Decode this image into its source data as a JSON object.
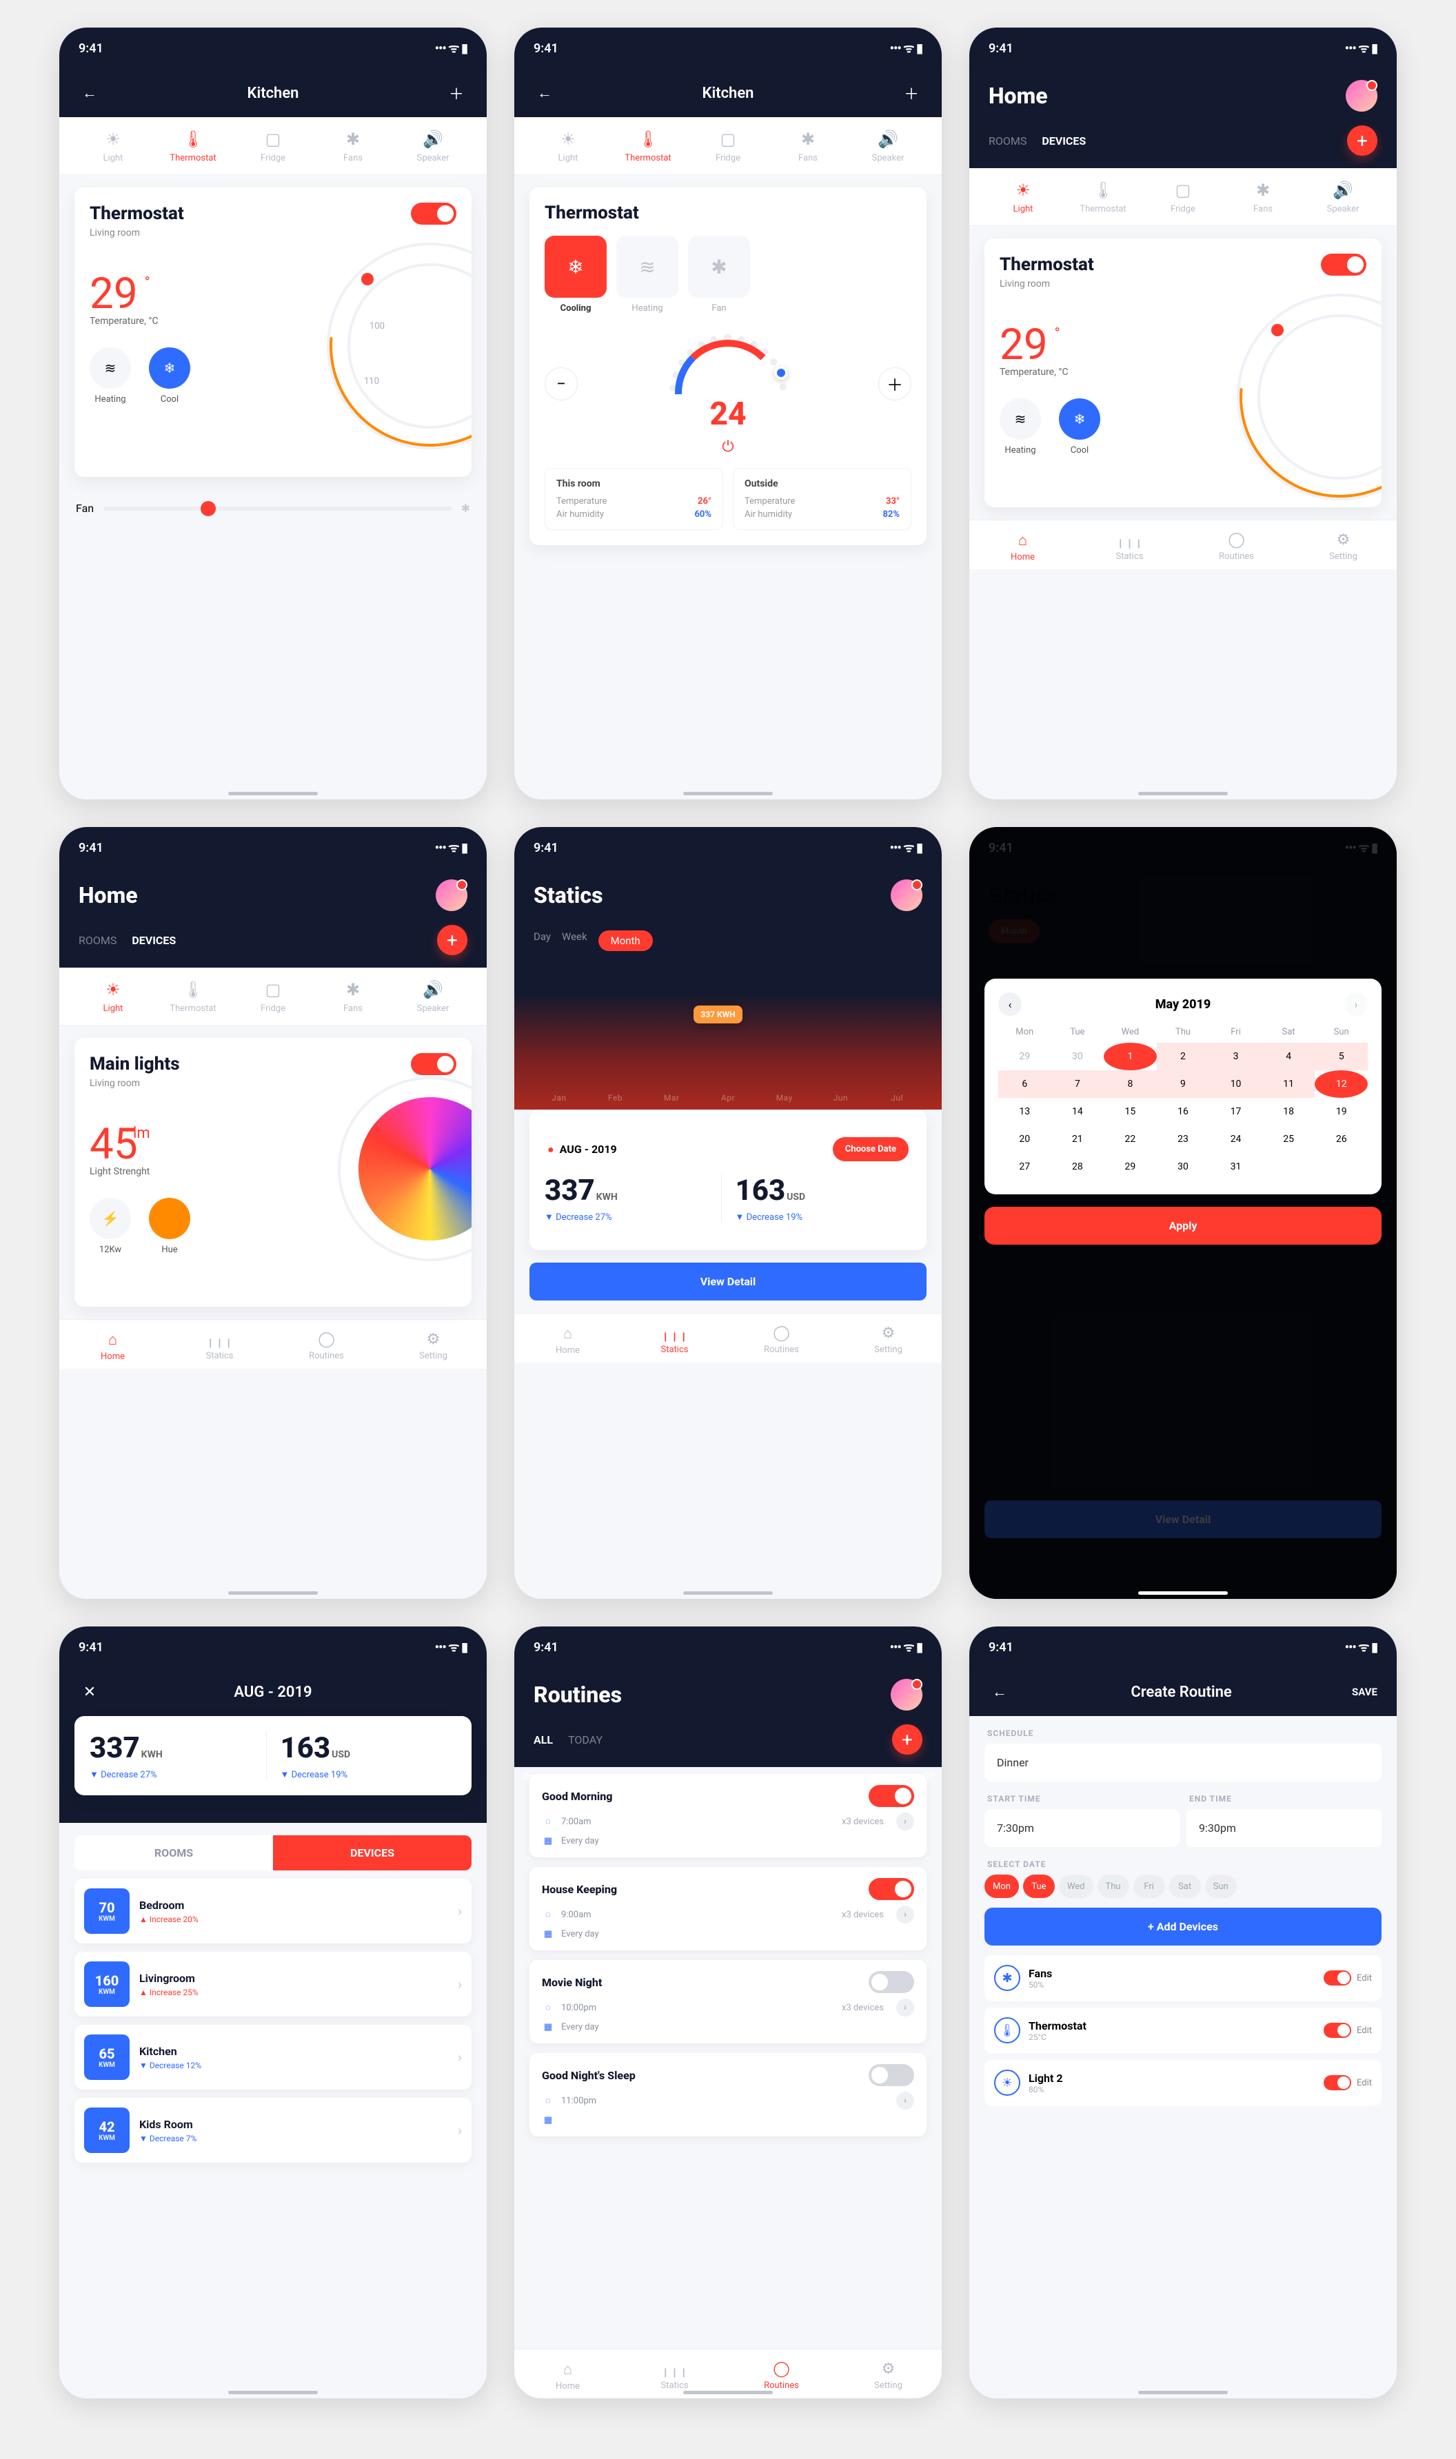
{
  "status_time": "9:41",
  "device_tabs": [
    {
      "icon": "☀",
      "label": "Light"
    },
    {
      "icon": "🌡",
      "label": "Thermostat"
    },
    {
      "icon": "▢",
      "label": "Fridge"
    },
    {
      "icon": "✱",
      "label": "Fans"
    },
    {
      "icon": "🔊",
      "label": "Speaker"
    }
  ],
  "screen1": {
    "title": "Kitchen",
    "card_title": "Thermostat",
    "sub": "Living room",
    "toggle": "On",
    "value": "29",
    "val_unit": "°",
    "val_label": "Temperature, °C",
    "modes": [
      {
        "icon": "≋",
        "label": "Heating"
      },
      {
        "icon": "❄",
        "label": "Cool"
      }
    ],
    "fan": "Fan",
    "ticks": [
      "100",
      "110"
    ]
  },
  "screen2": {
    "title": "Kitchen",
    "card_title": "Thermostat",
    "tiles": [
      {
        "icon": "❄",
        "label": "Cooling"
      },
      {
        "icon": "≋",
        "label": "Heating"
      },
      {
        "icon": "✱",
        "label": "Fan"
      }
    ],
    "value": "24",
    "boxes": [
      {
        "t": "This room",
        "l1": "Temperature",
        "v1": "26°",
        "l2": "Air humidity",
        "v2": "60%"
      },
      {
        "t": "Outside",
        "l1": "Temperature",
        "v1": "33°",
        "l2": "Air humidity",
        "v2": "82%"
      }
    ]
  },
  "screen3": {
    "title": "Home",
    "tabs": [
      "ROOMS",
      "DEVICES"
    ],
    "nav": [
      "Home",
      "Statics",
      "Routines",
      "Setting"
    ],
    "card_title": "Thermostat",
    "sub": "Living room",
    "value": "29",
    "val_unit": "°",
    "val_label": "Temperature, °C",
    "modes": [
      {
        "icon": "≋",
        "label": "Heating"
      },
      {
        "icon": "❄",
        "label": "Cool"
      }
    ]
  },
  "screen4": {
    "title": "Home",
    "tabs": [
      "ROOMS",
      "DEVICES"
    ],
    "card_title": "Main lights",
    "sub": "Living room",
    "toggle": "On",
    "value": "45",
    "val_unit": "lm",
    "val_label": "Light Strenght",
    "modes": [
      {
        "icon": "⚡",
        "label": "12Kw"
      },
      {
        "icon": "●",
        "label": "Hue"
      }
    ],
    "nav": [
      "Home",
      "Statics",
      "Routines",
      "Setting"
    ]
  },
  "screen5": {
    "title": "Statics",
    "ranges": [
      "Day",
      "Week",
      "Month"
    ],
    "tooltip": "337 KWH",
    "months": [
      "Jan",
      "Feb",
      "Mar",
      "Apr",
      "May",
      "Jun",
      "Jul"
    ],
    "date": "AUG - 2019",
    "choose": "Choose Date",
    "m1": {
      "v": "337",
      "u": "KWH",
      "s": "▼ Decrease 27%"
    },
    "m2": {
      "v": "163",
      "u": "USD",
      "s": "▼ Decrease 19%"
    },
    "cta": "View Detail",
    "nav": [
      "Home",
      "Statics",
      "Routines",
      "Setting"
    ]
  },
  "screen6": {
    "title": "Statics",
    "range_current": "Month",
    "month": "May 2019",
    "dow": [
      "Mon",
      "Tue",
      "Wed",
      "Thu",
      "Fri",
      "Sat",
      "Sun"
    ],
    "apply": "Apply",
    "cta": "View Detail"
  },
  "screen7": {
    "title": "AUG - 2019",
    "m1": {
      "v": "337",
      "u": "KWH",
      "s": "▼ Decrease 27%"
    },
    "m2": {
      "v": "163",
      "u": "USD",
      "s": "▼ Decrease 19%"
    },
    "segs": [
      "ROOMS",
      "DEVICES"
    ],
    "rooms": [
      {
        "v": "70",
        "name": "Bedroom",
        "chg": "▲ Increase 20%",
        "cls": "up"
      },
      {
        "v": "160",
        "name": "Livingroom",
        "chg": "▲ Increase 25%",
        "cls": "up"
      },
      {
        "v": "65",
        "name": "Kitchen",
        "chg": "▼ Decrease 12%",
        "cls": "down"
      },
      {
        "v": "42",
        "name": "Kids Room",
        "chg": "▼ Decrease 7%",
        "cls": "down"
      }
    ],
    "badge_unit": "KWM"
  },
  "screen8": {
    "title": "Routines",
    "tabs": [
      "ALL",
      "TODAY"
    ],
    "routines": [
      {
        "name": "Good Morning",
        "on": true,
        "onlabel": "On",
        "time": "7:00am",
        "rep": "Every day",
        "note": "x3 devices"
      },
      {
        "name": "House Keeping",
        "on": true,
        "onlabel": "On",
        "time": "9:00am",
        "rep": "Every day",
        "note": "x3 devices"
      },
      {
        "name": "Movie Night",
        "on": false,
        "onlabel": "Off",
        "time": "10:00pm",
        "rep": "Every day",
        "note": "x3 devices"
      },
      {
        "name": "Good Night's Sleep",
        "on": false,
        "onlabel": "",
        "time": "11:00pm",
        "rep": "",
        "note": ""
      }
    ],
    "nav": [
      "Home",
      "Statics",
      "Routines",
      "Setting"
    ]
  },
  "screen9": {
    "title": "Create Routine",
    "save": "SAVE",
    "sec_schedule": "SCHEDULE",
    "schedule": "Dinner",
    "sec_start": "START TIME",
    "start": "7:30pm",
    "sec_end": "END TIME",
    "end": "9:30pm",
    "sec_days": "SELECT DATE",
    "days": [
      "Mon",
      "Tue",
      "Wed",
      "Thu",
      "Fri",
      "Sat",
      "Sun"
    ],
    "add": "+   Add Devices",
    "devices": [
      {
        "icon": "✱",
        "name": "Fans",
        "sub": "50%"
      },
      {
        "icon": "🌡",
        "name": "Thermostat",
        "sub": "25°C"
      },
      {
        "icon": "☀",
        "name": "Light 2",
        "sub": "80%"
      }
    ],
    "edit": "Edit"
  }
}
